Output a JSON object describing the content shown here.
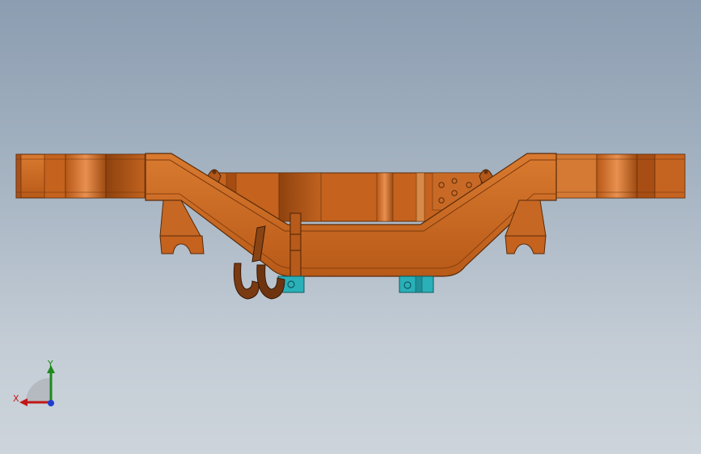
{
  "viewport": {
    "background_top": "#8c9db1",
    "background_bottom": "#cdd4db"
  },
  "model": {
    "body_color": "#c8651e",
    "highlight_color": "#e08a40",
    "shadow_color": "#9c4a10",
    "edge_color": "#5a2a08",
    "hook_color": "#7a3a12",
    "bracket_color": "#2ab0b8"
  },
  "triad": {
    "x_label": "X",
    "y_label": "Y",
    "x_color": "#c01818",
    "y_color": "#1e8a1e",
    "z_color": "#1e3ed0"
  }
}
